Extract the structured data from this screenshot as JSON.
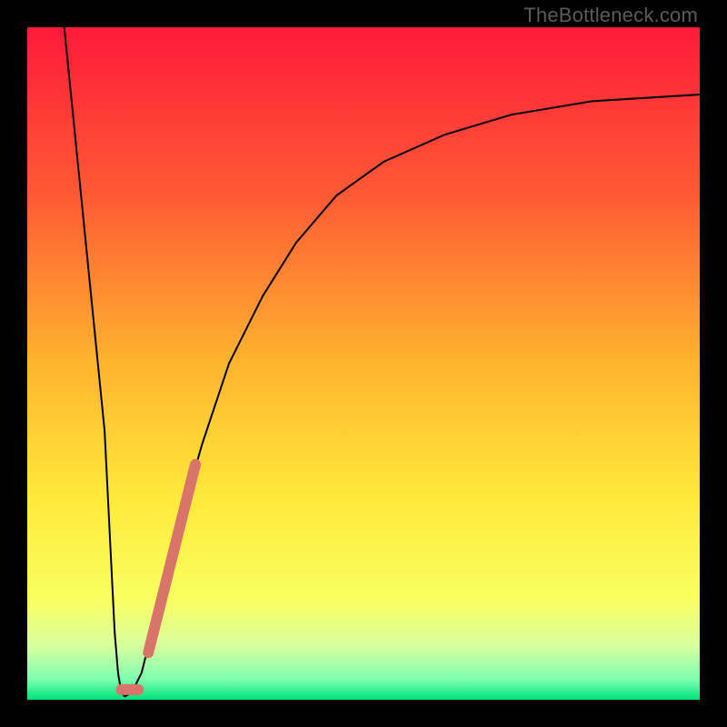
{
  "watermark": "TheBottleneck.com",
  "chart_data": {
    "type": "line",
    "title": "",
    "xlabel": "",
    "ylabel": "",
    "xlim": [
      0,
      100
    ],
    "ylim": [
      0,
      100
    ],
    "gradient_stops": [
      {
        "offset": 0,
        "color": "#ff1a3a"
      },
      {
        "offset": 25,
        "color": "#ff5a34"
      },
      {
        "offset": 50,
        "color": "#ffb42e"
      },
      {
        "offset": 70,
        "color": "#ffe93a"
      },
      {
        "offset": 85,
        "color": "#f9ff60"
      },
      {
        "offset": 92,
        "color": "#d8ff9e"
      },
      {
        "offset": 97,
        "color": "#7bffb0"
      },
      {
        "offset": 100,
        "color": "#00e27a"
      }
    ],
    "series": [
      {
        "name": "bottleneck-curve",
        "stroke": "#000000",
        "stroke_width": 2,
        "points": [
          {
            "x": 5.5,
            "y": 100
          },
          {
            "x": 6.5,
            "y": 90
          },
          {
            "x": 7.5,
            "y": 80
          },
          {
            "x": 8.5,
            "y": 70
          },
          {
            "x": 9.5,
            "y": 60
          },
          {
            "x": 10.5,
            "y": 50
          },
          {
            "x": 11.5,
            "y": 40
          },
          {
            "x": 12.0,
            "y": 30
          },
          {
            "x": 12.5,
            "y": 20
          },
          {
            "x": 13.0,
            "y": 10
          },
          {
            "x": 13.5,
            "y": 4
          },
          {
            "x": 14.0,
            "y": 1
          },
          {
            "x": 14.5,
            "y": 0.5
          },
          {
            "x": 15.5,
            "y": 1
          },
          {
            "x": 17.0,
            "y": 4
          },
          {
            "x": 19.0,
            "y": 12
          },
          {
            "x": 22.0,
            "y": 24
          },
          {
            "x": 26.0,
            "y": 38
          },
          {
            "x": 30.0,
            "y": 50
          },
          {
            "x": 35.0,
            "y": 60
          },
          {
            "x": 40.0,
            "y": 68
          },
          {
            "x": 46.0,
            "y": 75
          },
          {
            "x": 53.0,
            "y": 80
          },
          {
            "x": 62.0,
            "y": 84
          },
          {
            "x": 72.0,
            "y": 87
          },
          {
            "x": 84.0,
            "y": 89
          },
          {
            "x": 100.0,
            "y": 90
          }
        ]
      },
      {
        "name": "highlight-short",
        "stroke": "#d9746b",
        "stroke_width": 12,
        "linecap": "round",
        "points": [
          {
            "x": 14.0,
            "y": 1.5
          },
          {
            "x": 16.5,
            "y": 1.5
          }
        ]
      },
      {
        "name": "highlight-long",
        "stroke": "#d9746b",
        "stroke_width": 12,
        "linecap": "round",
        "points": [
          {
            "x": 18.0,
            "y": 7
          },
          {
            "x": 25.0,
            "y": 35
          }
        ]
      }
    ]
  }
}
